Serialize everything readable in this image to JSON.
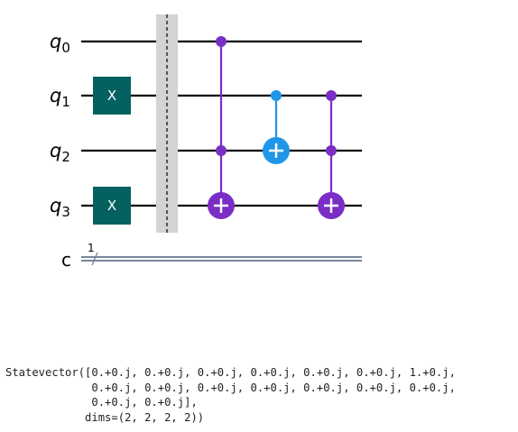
{
  "circuit": {
    "qubits": [
      {
        "name": "q",
        "index": "0"
      },
      {
        "name": "q",
        "index": "1"
      },
      {
        "name": "q",
        "index": "2"
      },
      {
        "name": "q",
        "index": "3"
      }
    ],
    "classical_register": {
      "name": "c",
      "bits": "1"
    },
    "gates": [
      {
        "type": "x",
        "label": "X",
        "target": 1
      },
      {
        "type": "x",
        "label": "X",
        "target": 3
      },
      {
        "type": "barrier",
        "qubits": [
          0,
          1,
          2,
          3
        ]
      },
      {
        "type": "ccx",
        "controls": [
          0,
          2
        ],
        "target": 3
      },
      {
        "type": "cx",
        "controls": [
          1
        ],
        "target": 2
      },
      {
        "type": "ccx",
        "controls": [
          1,
          2
        ],
        "target": 3
      }
    ],
    "colors": {
      "x_gate": "#05615f",
      "ccx": "#7a2ec6",
      "cx": "#1f96e8",
      "barrier": "#d3d3d3",
      "wire": "#000000",
      "classical_wire": "#778899"
    }
  },
  "output": {
    "lines": [
      "Statevector([0.+0.j, 0.+0.j, 0.+0.j, 0.+0.j, 0.+0.j, 0.+0.j, 1.+0.j,",
      "             0.+0.j, 0.+0.j, 0.+0.j, 0.+0.j, 0.+0.j, 0.+0.j, 0.+0.j,",
      "             0.+0.j, 0.+0.j],",
      "            dims=(2, 2, 2, 2))"
    ]
  }
}
